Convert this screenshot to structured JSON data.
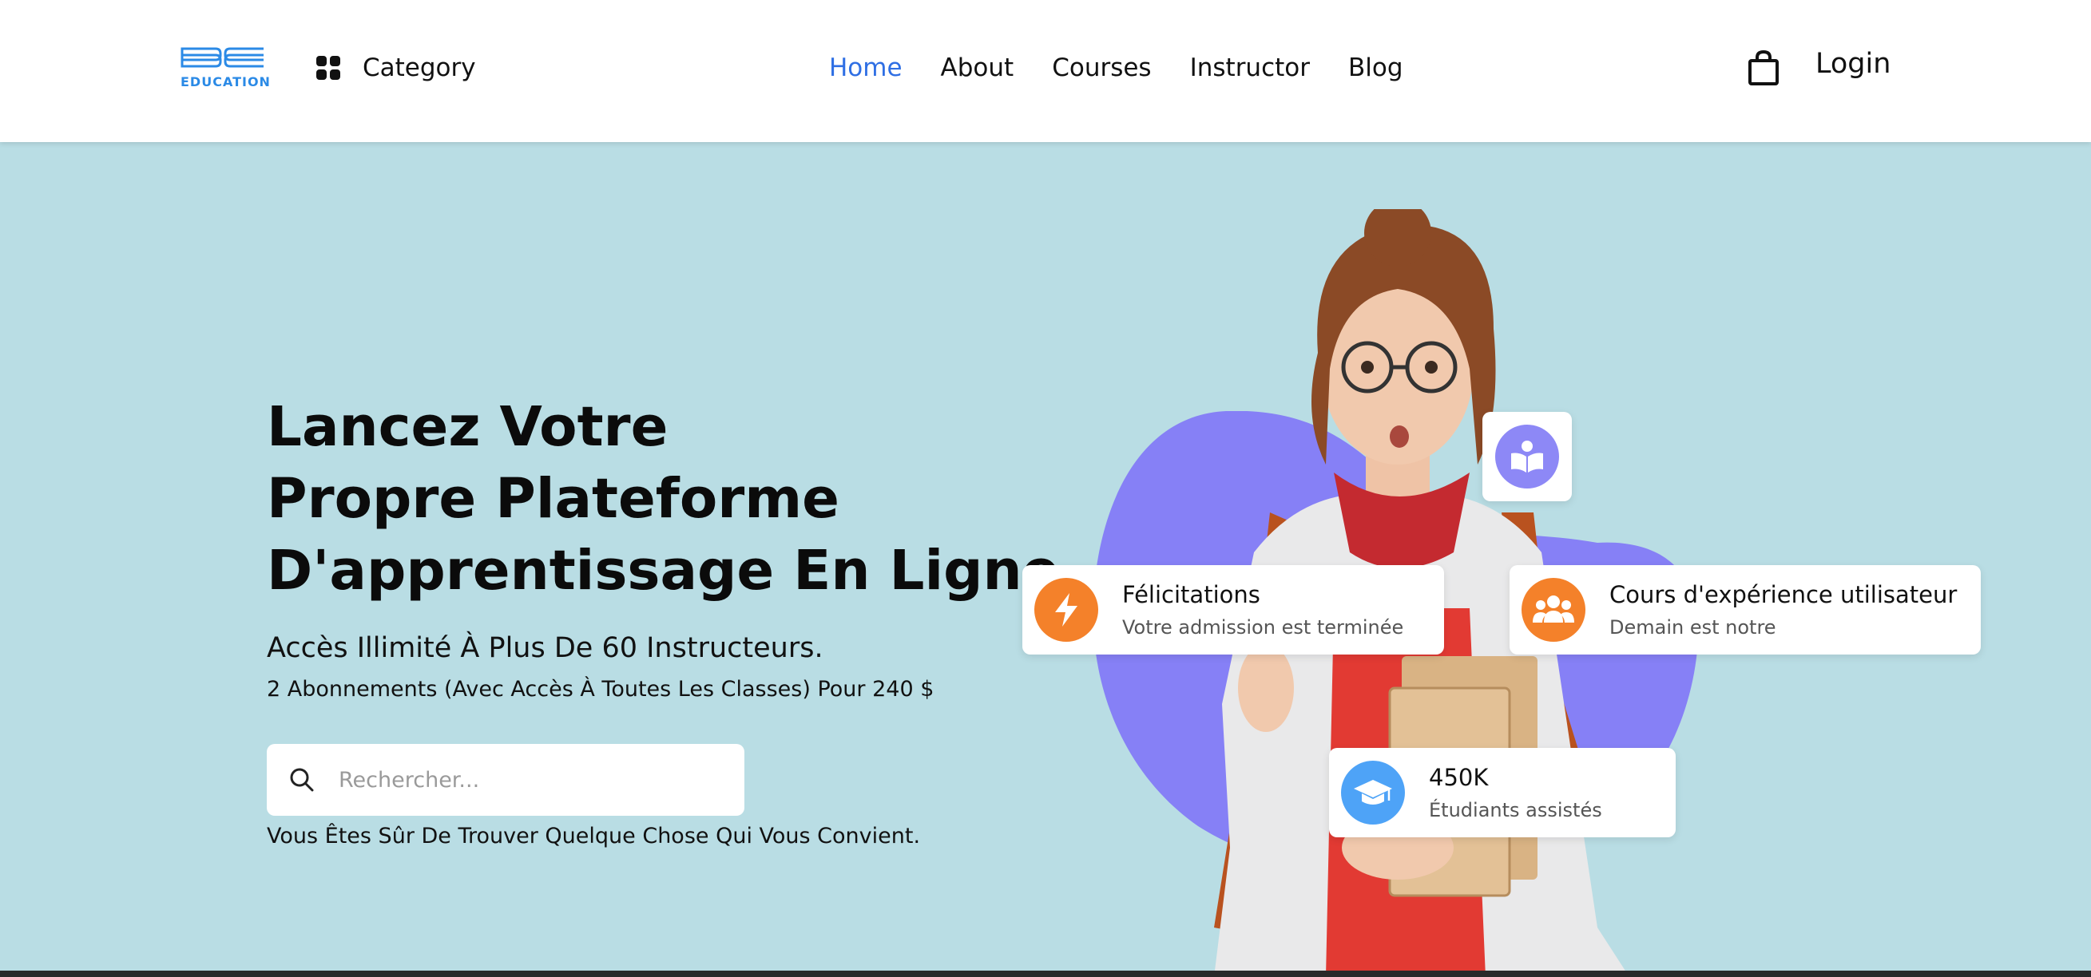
{
  "header": {
    "logo_text": "EDUCATION",
    "category_label": "Category",
    "nav": [
      {
        "label": "Home",
        "active": true
      },
      {
        "label": "About",
        "active": false
      },
      {
        "label": "Courses",
        "active": false
      },
      {
        "label": "Instructor",
        "active": false
      },
      {
        "label": "Blog",
        "active": false
      }
    ],
    "login_label": "Login",
    "icons": {
      "category": "grid-icon",
      "cart": "shopping-bag-icon"
    }
  },
  "hero": {
    "headline": [
      "Lancez Votre",
      "Propre Plateforme",
      "D'apprentissage En Ligne"
    ],
    "subline1": "Accès Illimité À Plus De 60 Instructeurs.",
    "subline2": "2 Abonnements (Avec Accès À Toutes Les Classes) Pour 240 $",
    "search_placeholder": "Rechercher...",
    "hint": "Vous Êtes Sûr De Trouver Quelque Chose Qui Vous Convient."
  },
  "cards": {
    "congrats": {
      "title": "Félicitations",
      "subtitle": "Votre admission est terminée",
      "icon": "lightning-icon"
    },
    "ux_course": {
      "title": "Cours d'expérience utilisateur",
      "subtitle": "Demain est notre",
      "icon": "users-icon"
    },
    "students": {
      "title": "450K",
      "subtitle": "Étudiants assistés",
      "icon": "graduation-cap-icon"
    },
    "reading": {
      "icon": "book-reader-icon"
    }
  },
  "colors": {
    "accent": "#2f6fe4",
    "background": "#b9dde4",
    "blob": "#8680f6",
    "orange": "#f4812a",
    "blue": "#4ea3f7",
    "purple": "#8d88f6"
  }
}
